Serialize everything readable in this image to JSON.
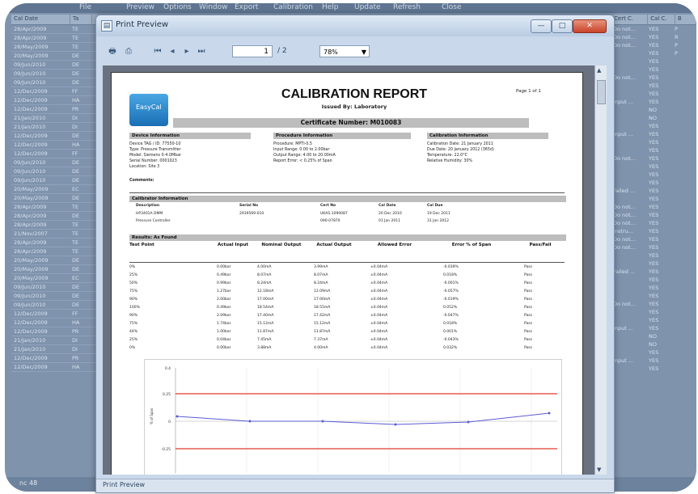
{
  "window": {
    "title": "Print Preview",
    "min_label": "—",
    "max_label": "□",
    "close_label": "✕"
  },
  "toolbar": {
    "page_current": "1",
    "page_total": "/ 2",
    "zoom": "78%"
  },
  "status": {
    "print_preview": "Print Preview",
    "bg_status": "nc 48"
  },
  "report": {
    "logo_text": "EasyCal",
    "title": "CALIBRATION REPORT",
    "issued_by": "Issued By: Laboratory",
    "page_of": "Page 1 of 1",
    "certificate": "Certificate Number: M010083",
    "device_header": "Device Information",
    "device_lines": [
      "Device TAG / ID: 77550-10",
      "Type: Pressure Transmitter",
      "Model: Siemens 0-4.0Mbar",
      "Serial Number: 0001023",
      "Location: Site 3"
    ],
    "procedure_header": "Procedure Information",
    "procedure_lines": [
      "Procedure: MPTI-0.5",
      "Input Range: 0.00 to 2.00bar",
      "Output Range: 4.00 to 20.00mA",
      "Report Error: < 0.25% of Span"
    ],
    "calibration_header": "Calibration Information",
    "calibration_lines": [
      "Calibration Date: 21 January 2011",
      "Due Date: 20 January 2012 (365d)",
      "Temperature: 22.0°C",
      "Relative Humidity: 30%"
    ],
    "comments_label": "Comments:",
    "calibrator_header": "Calibrator Information",
    "calibrator_cols": [
      "Description",
      "Serial No",
      "Cert No",
      "Cal Date",
      "Cal Due"
    ],
    "calibrator_rows": [
      [
        "HP3401A DMM",
        "2939569-010",
        "UKAS-1090087",
        "20 Dec 2010",
        "19 Dec 2011"
      ],
      [
        "Pressure Controller",
        "",
        "090-07870",
        "01 Jan 2011",
        "31 Jan 2012"
      ]
    ],
    "results_header": "Results: As Found",
    "results_cols": [
      "Test Point",
      "Actual Input",
      "Nominal Output",
      "Actual Output",
      "Allowed Error",
      "Error % of Span",
      "Pass/Fail"
    ],
    "results_rows": [
      [
        "0%",
        "0.00bar",
        "4.00mA",
        "3.99mA",
        "±0.04mA",
        "-0.039%",
        "Pass"
      ],
      [
        "25%",
        "0.49bar",
        "8.07mA",
        "8.07mA",
        "±0.04mA",
        "0.018%",
        "Pass"
      ],
      [
        "50%",
        "0.99bar",
        "8.24mA",
        "8.24mA",
        "±0.04mA",
        "-0.001%",
        "Pass"
      ],
      [
        "75%",
        "1.27bar",
        "12.18mA",
        "12.09mA",
        "±0.04mA",
        "-0.057%",
        "Pass"
      ],
      [
        "90%",
        "2.00bar",
        "17.00mA",
        "17.00mA",
        "±0.04mA",
        "-0.019%",
        "Pass"
      ],
      [
        "100%",
        "0.49bar",
        "18.54mA",
        "18.55mA",
        "±0.04mA",
        "0.052%",
        "Pass"
      ],
      [
        "90%",
        "2.09bar",
        "17.40mA",
        "17.42mA",
        "±0.04mA",
        "-0.047%",
        "Pass"
      ],
      [
        "75%",
        "1.74bar",
        "15.12mA",
        "15.12mA",
        "±0.04mA",
        "0.018%",
        "Pass"
      ],
      [
        "44%",
        "1.00bar",
        "11.87mA",
        "11.87mA",
        "±0.04mA",
        "0.001%",
        "Pass"
      ],
      [
        "25%",
        "0.04bar",
        "7.45mA",
        "7.37mA",
        "±0.04mA",
        "-0.043%",
        "Pass"
      ],
      [
        "0%",
        "0.00bar",
        "3.88mA",
        "4.00mA",
        "±0.04mA",
        "0.032%",
        "Pass"
      ]
    ],
    "chart_ticks": [
      "0.4",
      "0.25",
      "0",
      "-0.25"
    ],
    "chart_ylabel": "% of Span"
  },
  "bg_grid": {
    "headers": [
      "Cal Date",
      "Ta"
    ],
    "dates": [
      "28/Apr/2009",
      "28/Apr/2009",
      "28/May/2009",
      "20/May/2009",
      "09/Jun/2010",
      "09/Jun/2010",
      "09/Jun/2010",
      "12/Dec/2009",
      "12/Dec/2009",
      "12/Dec/2009",
      "21/Jan/2010",
      "21/Jan/2010",
      "12/Dec/2009",
      "12/Dec/2009",
      "12/Dec/2009",
      "09/Jun/2010",
      "09/Jun/2010",
      "09/Jun/2010",
      "20/May/2009",
      "20/May/2009",
      "28/Apr/2009",
      "28/Apr/2009",
      "28/Apr/2009",
      "21/Nov/2007",
      "28/Apr/2009",
      "28/Apr/2009",
      "20/May/2009",
      "20/May/2009",
      "20/May/2009",
      "09/Jun/2010",
      "09/Jun/2010",
      "09/Jun/2010",
      "12/Dec/2009",
      "12/Dec/2009",
      "12/Dec/2009",
      "21/Jan/2010",
      "21/Jan/2010",
      "12/Dec/2009",
      "12/Dec/2009"
    ],
    "codes": [
      "TE",
      "TE",
      "TE",
      "DE",
      "DE",
      "DE",
      "DE",
      "FF",
      "HA",
      "PR",
      "DI",
      "DI",
      "DE",
      "HA",
      "FF",
      "DE",
      "DE",
      "DE",
      "EC",
      "DE",
      "TE",
      "DE",
      "TE",
      "TE",
      "TE",
      "TE",
      "DE",
      "DE",
      "EC",
      "DE",
      "DE",
      "DE",
      "FF",
      "HA",
      "PR",
      "DI",
      "DI",
      "PR",
      "HA"
    ],
    "right_headers": [
      "Cert C.",
      "Cal C.",
      "B"
    ],
    "right_rows": [
      [
        "Do not...",
        "YES",
        "P"
      ],
      [
        "Do not...",
        "YES",
        "R"
      ],
      [
        "Do not...",
        "YES",
        "P"
      ],
      [
        "",
        "YES",
        "P"
      ],
      [
        "",
        "YES",
        ""
      ],
      [
        "",
        "YES",
        ""
      ],
      [
        "Do not...",
        "YES",
        ""
      ],
      [
        "",
        "YES",
        ""
      ],
      [
        "",
        "YES",
        ""
      ],
      [
        "Input ...",
        "YES",
        ""
      ],
      [
        "",
        "NO",
        ""
      ],
      [
        "",
        "NO",
        ""
      ],
      [
        "",
        "YES",
        ""
      ],
      [
        "Input ...",
        "YES",
        ""
      ],
      [
        "",
        "YES",
        ""
      ],
      [
        "",
        "YES",
        ""
      ],
      [
        "Do not...",
        "YES",
        ""
      ],
      [
        "",
        "YES",
        ""
      ],
      [
        "",
        "YES",
        ""
      ],
      [
        "",
        "YES",
        ""
      ],
      [
        "Failed ...",
        "YES",
        ""
      ],
      [
        "",
        "YES",
        ""
      ],
      [
        "Do not...",
        "YES",
        ""
      ],
      [
        "Do not...",
        "YES",
        ""
      ],
      [
        "Do not...",
        "YES",
        ""
      ],
      [
        "Instru...",
        "YES",
        ""
      ],
      [
        "Do not...",
        "YES",
        ""
      ],
      [
        "Do not...",
        "YES",
        ""
      ],
      [
        "",
        "YES",
        ""
      ],
      [
        "",
        "YES",
        ""
      ],
      [
        "Failed ...",
        "YES",
        ""
      ],
      [
        "",
        "YES",
        ""
      ],
      [
        "",
        "YES",
        ""
      ],
      [
        "",
        "YES",
        ""
      ],
      [
        "Do not...",
        "YES",
        ""
      ],
      [
        "",
        "YES",
        ""
      ],
      [
        "",
        "YES",
        ""
      ],
      [
        "Input ...",
        "YES",
        ""
      ],
      [
        "",
        "NO",
        ""
      ],
      [
        "",
        "NO",
        ""
      ],
      [
        "",
        "YES",
        ""
      ],
      [
        "Input ...",
        "YES",
        ""
      ],
      [
        "",
        "YES",
        ""
      ]
    ]
  },
  "menu": [
    "File",
    "Preview",
    "Options",
    "Window",
    "Export",
    "Calibration",
    "Help",
    "Update",
    "Refresh",
    "Close"
  ]
}
